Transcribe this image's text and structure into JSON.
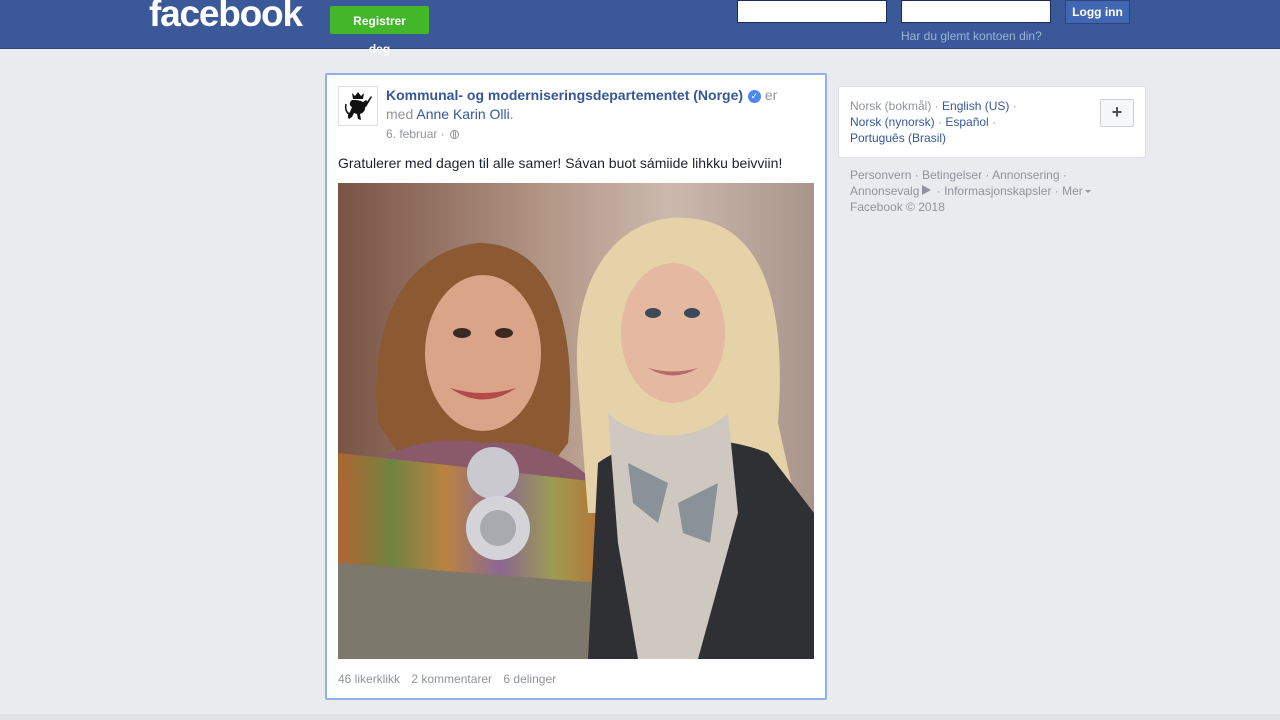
{
  "header": {
    "logo": "facebook",
    "register_label": "Registrer deg",
    "email_value": "",
    "password_value": "",
    "login_label": "Logg inn",
    "forgot_label": "Har du glemt kontoen din?",
    "brand_color": "#3b5998",
    "register_color": "#42b72a"
  },
  "post": {
    "page_name": "Kommunal- og moderniseringsdepartementet (Norge)",
    "verified_icon": "verified-badge-icon",
    "with_word": "er med",
    "tagged_person": "Anne Karin Olli",
    "date": "6. februar",
    "audience_icon": "globe-icon",
    "text": "Gratulerer med dagen til alle samer! Sávan buot sámiide lihkku beivviin!",
    "likes": "46 likerklikk",
    "comments": "2 kommentarer",
    "shares": "6 delinger"
  },
  "languages": {
    "current": "Norsk (bokmål)",
    "items": [
      "English (US)",
      "Norsk (nynorsk)",
      "Español",
      "Português (Brasil)"
    ],
    "add_label": "+"
  },
  "footer": {
    "links": [
      "Personvern",
      "Betingelser",
      "Annonsering",
      "Annonsevalg",
      "Informasjonskapsler",
      "Mer"
    ],
    "copyright": "Facebook © 2018"
  }
}
